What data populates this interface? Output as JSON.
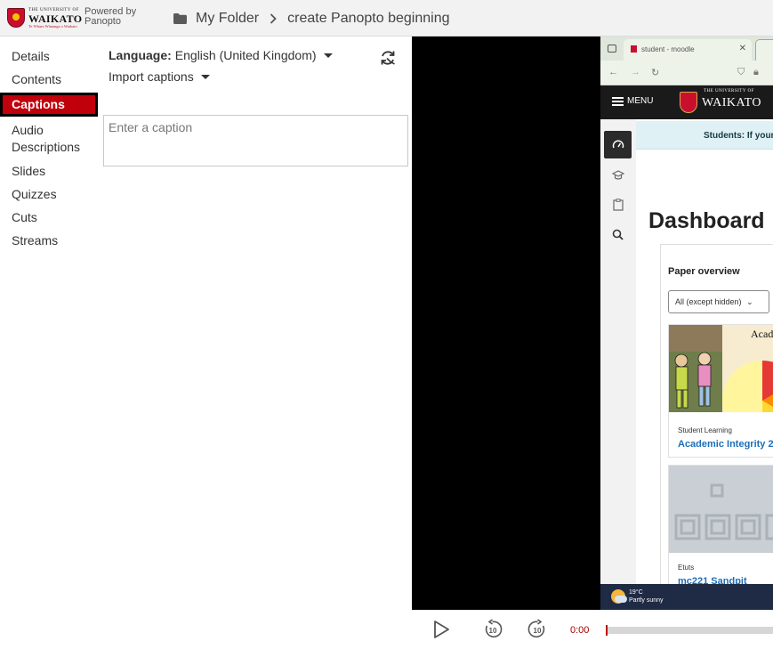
{
  "header": {
    "logo": {
      "university_line": "THE UNIVERSITY OF",
      "name": "WAIKATO",
      "motto": "Te Whare Wānanga o Waikato"
    },
    "powered_by": "Powered by",
    "powered_brand": "Panopto",
    "breadcrumb": {
      "folder": "My Folder",
      "session": "create Panopto beginning"
    }
  },
  "nav": {
    "items": [
      "Details",
      "Contents",
      "Captions",
      "Audio Descriptions",
      "Slides",
      "Quizzes",
      "Cuts",
      "Streams"
    ],
    "active": "Captions"
  },
  "captions": {
    "language_label": "Language:",
    "language_value": "English (United Kingdom)",
    "import_label": "Import captions",
    "input_placeholder": "Enter a caption",
    "icons": {
      "refresh": "refresh-icon",
      "caret": "caret-down-icon"
    }
  },
  "video": {
    "browser_tab": "student - moodle",
    "site_menu": "MENU",
    "site_logo": "WAIKATO",
    "site_logo_small": "THE UNIVERSITY OF",
    "notice": "Students: If your",
    "dashboard_title": "Dashboard",
    "paper_overview": "Paper overview",
    "filter": "All (except hidden)",
    "course1_image_text": "Acad Inte",
    "course1_category": "Student Learning",
    "course1_name": "Academic Integrity 2",
    "course2_category": "Etuts",
    "course2_name": "mc221 Sandpit",
    "weather_temp": "19°C",
    "weather_desc": "Partly sunny"
  },
  "player": {
    "time": "0:00",
    "rewind_seconds": "10",
    "forward_seconds": "10",
    "progress": 0
  },
  "colors": {
    "accent": "#c0000b",
    "header_bg": "#f2f2f2",
    "link_blue": "#1d6fb8"
  }
}
